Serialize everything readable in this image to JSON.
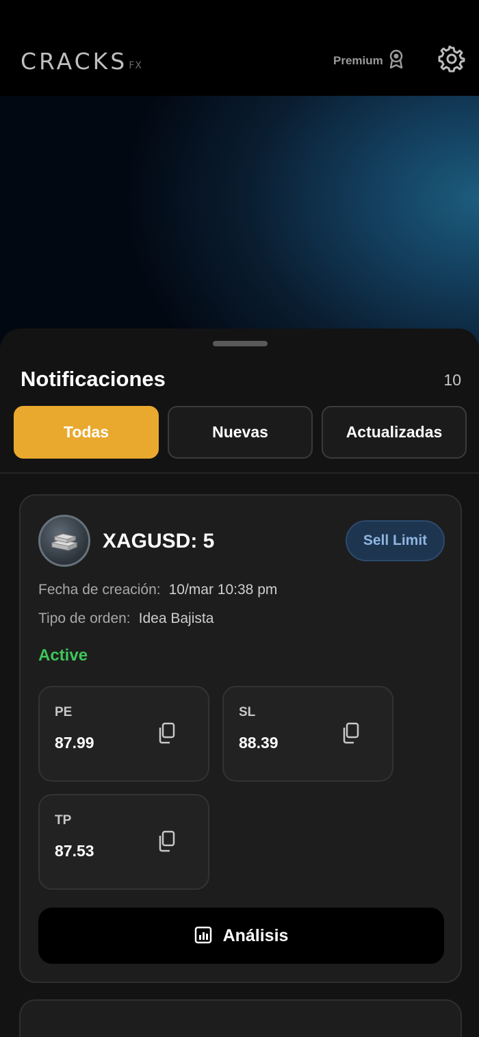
{
  "header": {
    "logo_main": "CRACKS",
    "logo_sub": "FX",
    "premium_label": "Premium"
  },
  "notifications": {
    "title": "Notificaciones",
    "count": "10",
    "tabs": [
      {
        "label": "Todas",
        "active": true
      },
      {
        "label": "Nuevas",
        "active": false
      },
      {
        "label": "Actualizadas",
        "active": false
      }
    ]
  },
  "card": {
    "symbol": "XAGUSD: 5",
    "order_badge": "Sell Limit",
    "created_label": "Fecha de creación:",
    "created_value": "10/mar 10:38 pm",
    "order_type_label": "Tipo de orden:",
    "order_type_value": "Idea Bajista",
    "status": "Active",
    "prices": [
      {
        "label": "PE",
        "value": "87.99"
      },
      {
        "label": "SL",
        "value": "88.39"
      },
      {
        "label": "TP",
        "value": "87.53"
      }
    ],
    "analysis_label": "Análisis"
  },
  "colors": {
    "accent": "#e9a92e",
    "status_active": "#3fc55a",
    "badge_text": "#8fb6e0"
  },
  "icons": {
    "premium": "award-ribbon-icon",
    "settings": "gear-icon",
    "copy": "copy-icon",
    "analysis": "chart-icon"
  }
}
